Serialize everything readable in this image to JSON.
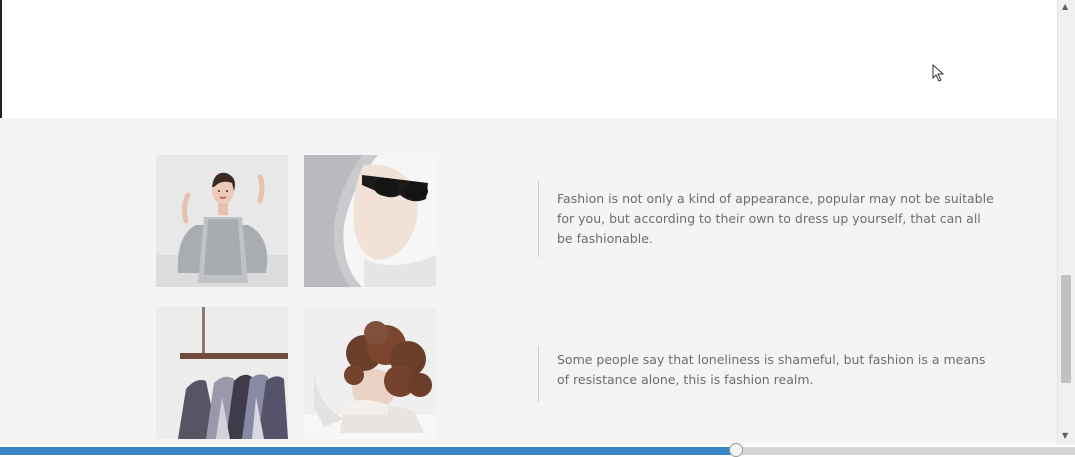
{
  "feature_rows": [
    {
      "images": [
        {
          "icon": "woman-in-sequin-dress-image"
        },
        {
          "icon": "hooded-man-sunglasses-image"
        }
      ],
      "quote": "Fashion is not only a kind of appearance, popular may not be suitable for you, but according to their own to dress up yourself, that can all be fashionable."
    },
    {
      "images": [
        {
          "icon": "clothing-rack-image"
        },
        {
          "icon": "curly-haired-person-image"
        }
      ],
      "quote": "Some people say that loneliness is shameful, but fashion is a means of resistance alone, this is fashion realm."
    }
  ],
  "video_progress": {
    "fraction": 0.684
  },
  "colors": {
    "progress_fill": "#3a86c8",
    "section_bg": "#f4f4f6",
    "quote_text": "#6d6d70"
  }
}
